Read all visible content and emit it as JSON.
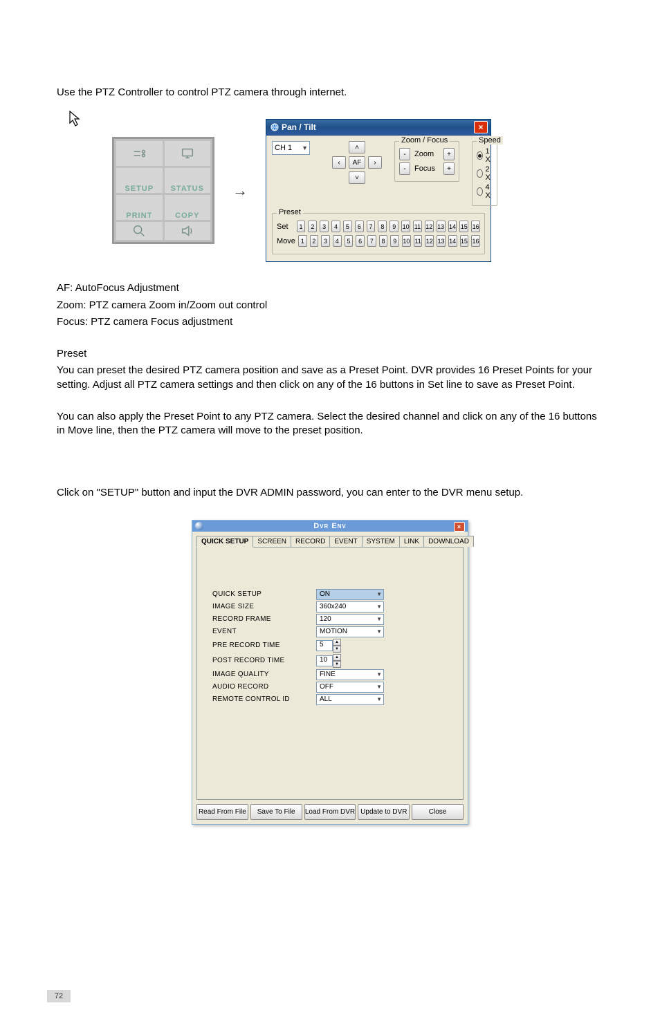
{
  "intro": "Use the PTZ Controller to control PTZ camera through internet.",
  "thumb_labels": {
    "setup": "SETUP",
    "status": "STATUS",
    "print": "PRINT",
    "copy": "COPY"
  },
  "arrow_glyph": "→",
  "pt": {
    "title": "Pan / Tilt",
    "close": "×",
    "channel": "CH 1",
    "joy": {
      "up": "˄",
      "down": "˅",
      "left": "‹",
      "right": "›",
      "af": "AF"
    },
    "zf": {
      "legend": "Zoom / Focus",
      "zoom_label": "Zoom",
      "focus_label": "Focus",
      "minus": "-",
      "plus": "+"
    },
    "speed": {
      "legend": "Speed",
      "o1": "1 X",
      "o2": "2 X",
      "o4": "4 X",
      "selected": "1 X"
    },
    "preset": {
      "legend": "Preset",
      "set_label": "Set",
      "move_label": "Move",
      "n": [
        "1",
        "2",
        "3",
        "4",
        "5",
        "6",
        "7",
        "8",
        "9",
        "10",
        "11",
        "12",
        "13",
        "14",
        "15",
        "16"
      ]
    }
  },
  "desc": {
    "af": "AF: AutoFocus Adjustment",
    "zoom": "Zoom: PTZ camera Zoom in/Zoom out control",
    "focus": "Focus: PTZ camera Focus adjustment"
  },
  "preset_heading": "Preset",
  "preset_para": "You can preset the desired PTZ camera position and save as a Preset Point. DVR provides 16 Preset Points for your setting. Adjust all PTZ camera settings and then click on any of the 16 buttons in Set line to save as Preset Point.",
  "move_para": "You can also apply the Preset Point to any PTZ camera. Select the desired channel and click on any of the 16 buttons in Move line, then the PTZ camera will move to the preset position.",
  "setup_line": "Click on \"SETUP\" button and input the DVR ADMIN password, you can enter to the DVR menu setup.",
  "env": {
    "title": "Dvr Env",
    "close": "×",
    "tabs": [
      "QUICK SETUP",
      "SCREEN",
      "RECORD",
      "EVENT",
      "SYSTEM",
      "LINK",
      "DOWNLOAD"
    ],
    "active_tab": "QUICK SETUP",
    "fields": {
      "quick_setup": {
        "label": "QUICK SETUP",
        "value": "ON",
        "type": "dropdown"
      },
      "image_size": {
        "label": "IMAGE SIZE",
        "value": "360x240",
        "type": "dropdown"
      },
      "record_frame": {
        "label": "RECORD FRAME",
        "value": "120",
        "type": "dropdown"
      },
      "event": {
        "label": "EVENT",
        "value": "MOTION",
        "type": "dropdown"
      },
      "pre_rec": {
        "label": "PRE RECORD TIME",
        "value": "5",
        "type": "spin"
      },
      "post_rec": {
        "label": "POST RECORD TIME",
        "value": "10",
        "type": "spin"
      },
      "image_q": {
        "label": "IMAGE QUALITY",
        "value": "FINE",
        "type": "dropdown"
      },
      "audio_rec": {
        "label": "AUDIO RECORD",
        "value": "OFF",
        "type": "dropdown"
      },
      "remote_id": {
        "label": "REMOTE CONTROL ID",
        "value": "ALL",
        "type": "dropdown"
      }
    },
    "buttons": [
      "Read From File",
      "Save To File",
      "Load From DVR",
      "Update to DVR",
      "Close"
    ]
  },
  "page_number": "72"
}
